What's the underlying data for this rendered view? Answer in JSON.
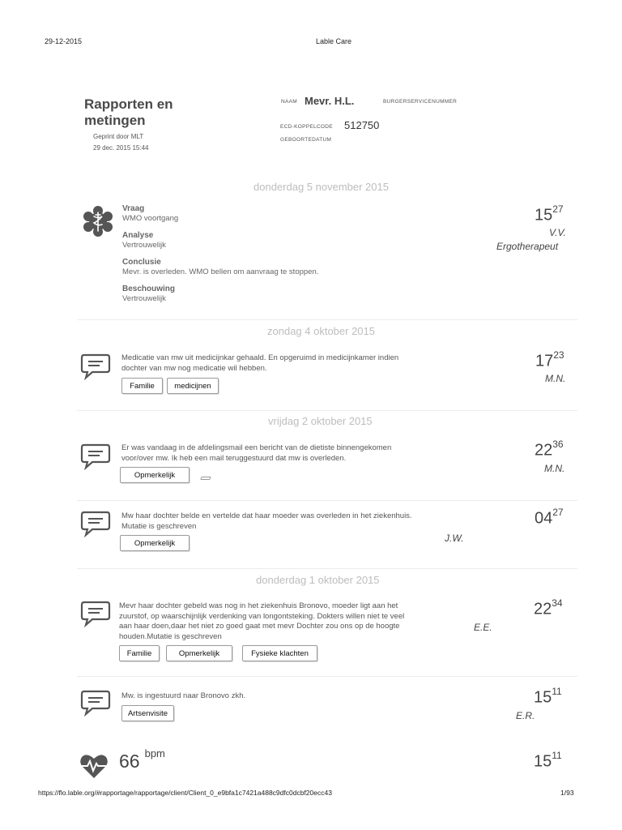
{
  "print_header": {
    "date": "29-12-2015",
    "title": "Lable Care"
  },
  "document": {
    "title": "Rapporten en metingen",
    "printed_by": "Geprint door MLT",
    "printed_at": "29 dec. 2015 15:44"
  },
  "client": {
    "naam_label": "NAAM",
    "naam_value": "Mevr. H.L.",
    "bsn_label": "BURGERSERVICENUMMER",
    "ecd_label": "ECD-KOPPELCODE",
    "ecd_value": "512750",
    "geboortedatum_label": "GEBOORTEDATUM"
  },
  "days": [
    {
      "label": "donderdag 5 november 2015"
    },
    {
      "label": "zondag 4 oktober 2015"
    },
    {
      "label": "vrijdag 2 oktober 2015"
    },
    {
      "label": "donderdag 1 oktober 2015"
    }
  ],
  "entries": {
    "e1": {
      "vraag_label": "Vraag",
      "vraag_value": "WMO voortgang",
      "analyse_label": "Analyse",
      "analyse_value": "Vertrouwelijk",
      "conclusie_label": "Conclusie",
      "conclusie_value": "Mevr. is overleden. WMO bellen om aanvraag te stoppen.",
      "beschouwing_label": "Beschouwing",
      "beschouwing_value": "Vertrouwelijk",
      "time_h": "15",
      "time_m": "27",
      "initials": "V.V.",
      "role": "Ergotherapeut",
      "icon": "medical-caduceus-icon"
    },
    "e2": {
      "line1": "Medicatie van mw uit medicijnkar gehaald. En opgeruimd in medicijnkamer indien",
      "line2": "dochter van mw nog medicatie wil hebben.",
      "tags": [
        "Familie",
        "medicijnen"
      ],
      "time_h": "17",
      "time_m": "23",
      "initials": "M.N.",
      "icon": "chat-bubble-icon"
    },
    "e3": {
      "line1": "Er was vandaag in de afdelingsmail een bericht van de dietiste binnengekomen",
      "line2": "voor/over mw. Ik heb een mail teruggestuurd dat mw is overleden.",
      "tags": [
        "Opmerkelijk"
      ],
      "time_h": "22",
      "time_m": "36",
      "initials": "M.N.",
      "icon": "chat-bubble-icon"
    },
    "e4": {
      "line1": "Mw haar dochter belde en vertelde dat haar moeder was overleden in het ziekenhuis.",
      "line2": "Mutatie is geschreven",
      "tags": [
        "Opmerkelijk"
      ],
      "time_h": "04",
      "time_m": "27",
      "initials": "J.W.",
      "icon": "chat-bubble-icon"
    },
    "e5": {
      "line1": "Mevr haar dochter gebeld was nog in het ziekenhuis Bronovo, moeder ligt aan het",
      "line2": "zuurstof, op waarschijnlijk verdenking van longontsteking. Dokters willen niet te veel",
      "line3": "aan haar doen,daar het niet zo goed gaat met mevr Dochter zou ons op de hoogte",
      "line4": "houden.Mutatie is geschreven",
      "tags": [
        "Familie",
        "Opmerkelijk",
        "Fysieke klachten"
      ],
      "time_h": "22",
      "time_m": "34",
      "initials": "E.E.",
      "icon": "chat-bubble-icon"
    },
    "e6": {
      "line1": "Mw. is ingestuurd naar Bronovo zkh.",
      "tags": [
        "Artsenvisite"
      ],
      "time_h": "15",
      "time_m": "11",
      "initials": "E.R.",
      "icon": "chat-bubble-icon"
    },
    "e7": {
      "value": "66",
      "unit": "bpm",
      "time_h": "15",
      "time_m": "11",
      "icon": "heart-rate-icon"
    }
  },
  "footer": {
    "url": "https://flo.lable.org/#rapportage/rapportage/client/Client_0_e9bfa1c7421a488c9dfc0dcbf20ecc43",
    "page": "1/93"
  }
}
